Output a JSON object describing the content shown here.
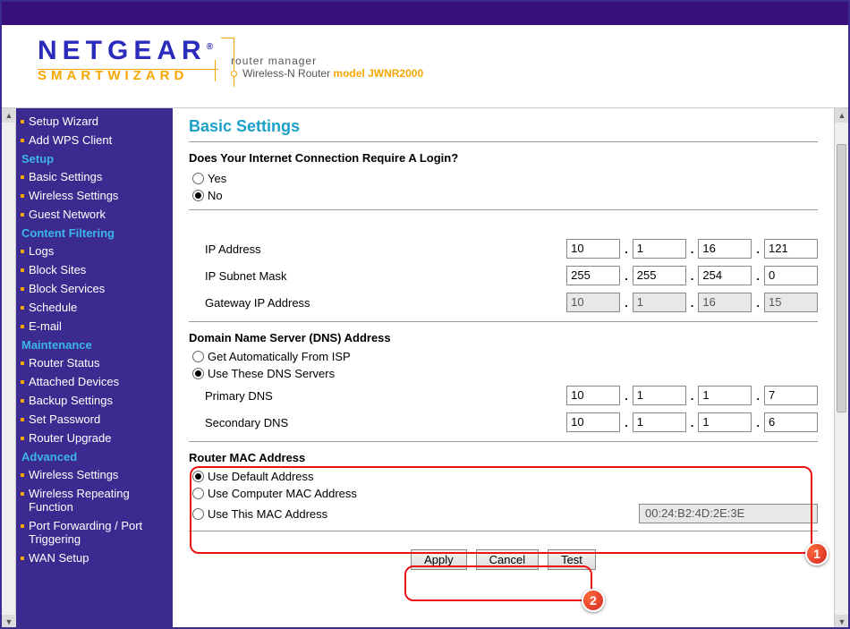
{
  "header": {
    "brand": "NETGEAR",
    "subbrand_smart": "SMART",
    "subbrand_wizard": "WIZARD",
    "line1": "router manager",
    "line2_prefix": "Wireless-N Router  ",
    "model": "model JWNR2000"
  },
  "sidebar": {
    "groups": [
      {
        "type": "item",
        "label": "Setup Wizard"
      },
      {
        "type": "item",
        "label": "Add WPS Client"
      },
      {
        "type": "heading",
        "label": "Setup"
      },
      {
        "type": "item",
        "label": "Basic Settings"
      },
      {
        "type": "item",
        "label": "Wireless Settings"
      },
      {
        "type": "item",
        "label": "Guest Network"
      },
      {
        "type": "heading",
        "label": "Content Filtering"
      },
      {
        "type": "item",
        "label": "Logs"
      },
      {
        "type": "item",
        "label": "Block Sites"
      },
      {
        "type": "item",
        "label": "Block Services"
      },
      {
        "type": "item",
        "label": "Schedule"
      },
      {
        "type": "item",
        "label": "E-mail"
      },
      {
        "type": "heading",
        "label": "Maintenance"
      },
      {
        "type": "item",
        "label": "Router Status"
      },
      {
        "type": "item",
        "label": "Attached Devices"
      },
      {
        "type": "item",
        "label": "Backup Settings"
      },
      {
        "type": "item",
        "label": "Set Password"
      },
      {
        "type": "item",
        "label": "Router Upgrade"
      },
      {
        "type": "heading",
        "label": "Advanced"
      },
      {
        "type": "item",
        "label": "Wireless Settings"
      },
      {
        "type": "item",
        "label": "Wireless Repeating Function"
      },
      {
        "type": "item",
        "label": "Port Forwarding / Port Triggering"
      },
      {
        "type": "item",
        "label": "WAN Setup"
      }
    ]
  },
  "main": {
    "title": "Basic Settings",
    "login_q": "Does Your Internet Connection Require A Login?",
    "yes": "Yes",
    "no": "No",
    "login_selected": "no",
    "ip": {
      "ip_label": "IP Address",
      "ip": [
        "10",
        "1",
        "16",
        "121"
      ],
      "subnet_label": "IP Subnet Mask",
      "subnet": [
        "255",
        "255",
        "254",
        "0"
      ],
      "gw_label": "Gateway IP Address",
      "gw": [
        "10",
        "1",
        "16",
        "15"
      ]
    },
    "dns": {
      "heading": "Domain Name Server (DNS) Address",
      "auto_label": "Get Automatically From ISP",
      "use_label": "Use These DNS Servers",
      "selected": "use",
      "primary_label": "Primary DNS",
      "primary": [
        "10",
        "1",
        "1",
        "7"
      ],
      "secondary_label": "Secondary DNS",
      "secondary": [
        "10",
        "1",
        "1",
        "6"
      ]
    },
    "mac": {
      "heading": "Router MAC Address",
      "default_label": "Use Default Address",
      "computer_label": "Use Computer MAC Address",
      "this_label": "Use This MAC Address",
      "selected": "default",
      "this_value": "00:24:B2:4D:2E:3E"
    },
    "buttons": {
      "apply": "Apply",
      "cancel": "Cancel",
      "test": "Test"
    }
  },
  "annotations": {
    "b1": "1",
    "b2": "2"
  }
}
